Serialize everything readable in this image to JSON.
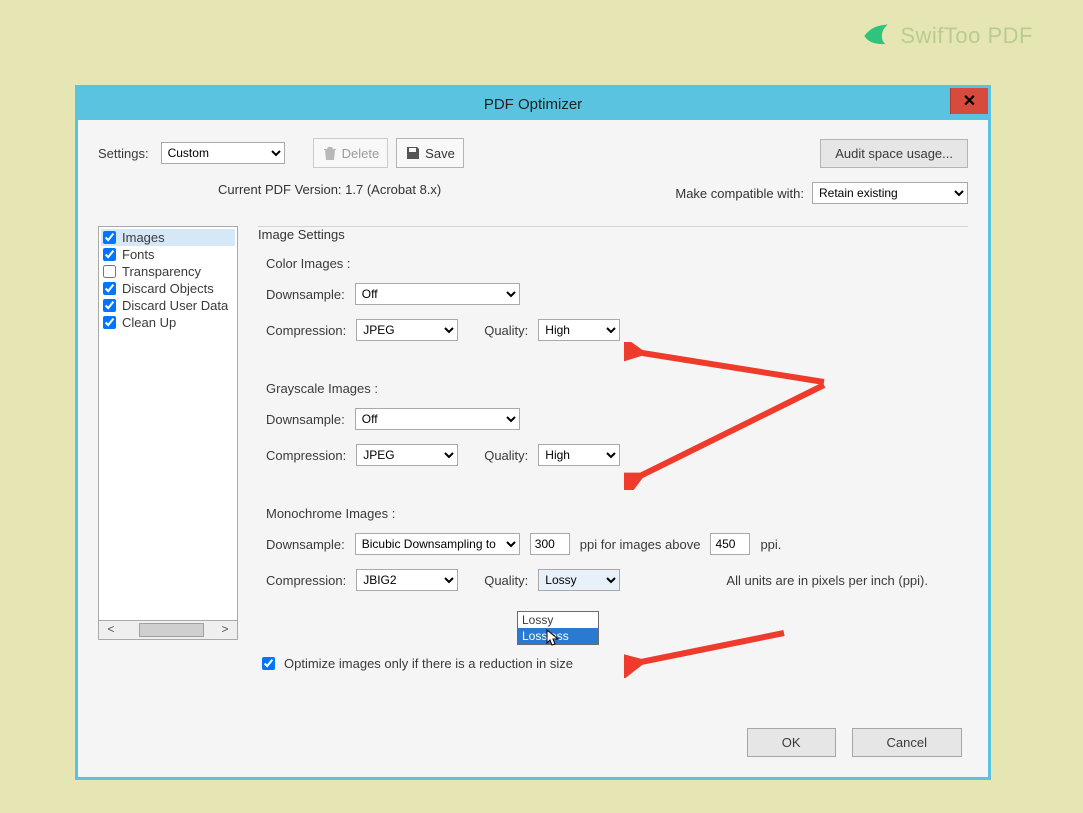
{
  "brand": "SwifToo PDF",
  "window": {
    "title": "PDF Optimizer",
    "settings_label": "Settings:",
    "settings_value": "Custom",
    "delete_label": "Delete",
    "save_label": "Save",
    "audit_label": "Audit space usage...",
    "version_text": "Current PDF Version: 1.7 (Acrobat 8.x)",
    "compat_label": "Make compatible with:",
    "compat_value": "Retain existing"
  },
  "sidebar": {
    "items": [
      {
        "label": "Images",
        "checked": true,
        "selected": true
      },
      {
        "label": "Fonts",
        "checked": true
      },
      {
        "label": "Transparency",
        "checked": false
      },
      {
        "label": "Discard Objects",
        "checked": true
      },
      {
        "label": "Discard User Data",
        "checked": true
      },
      {
        "label": "Clean Up",
        "checked": true
      }
    ]
  },
  "main": {
    "section_title": "Image Settings",
    "color": {
      "title": "Color Images :",
      "downsample_label": "Downsample:",
      "downsample_value": "Off",
      "compression_label": "Compression:",
      "compression_value": "JPEG",
      "quality_label": "Quality:",
      "quality_value": "High"
    },
    "gray": {
      "title": "Grayscale Images :",
      "downsample_label": "Downsample:",
      "downsample_value": "Off",
      "compression_label": "Compression:",
      "compression_value": "JPEG",
      "quality_label": "Quality:",
      "quality_value": "High"
    },
    "mono": {
      "title": "Monochrome Images :",
      "downsample_label": "Downsample:",
      "downsample_value": "Bicubic Downsampling to",
      "ppi1": "300",
      "ppi_mid": "ppi for images above",
      "ppi2": "450",
      "ppi_end": "ppi.",
      "compression_label": "Compression:",
      "compression_value": "JBIG2",
      "quality_label": "Quality:",
      "quality_value": "Lossy",
      "dropdown": {
        "opt1": "Lossy",
        "opt2": "Lossless"
      }
    },
    "units_note": "All units are in pixels per inch (ppi).",
    "optimize_cb": "Optimize images only if there is a reduction in size"
  },
  "footer": {
    "ok": "OK",
    "cancel": "Cancel"
  }
}
